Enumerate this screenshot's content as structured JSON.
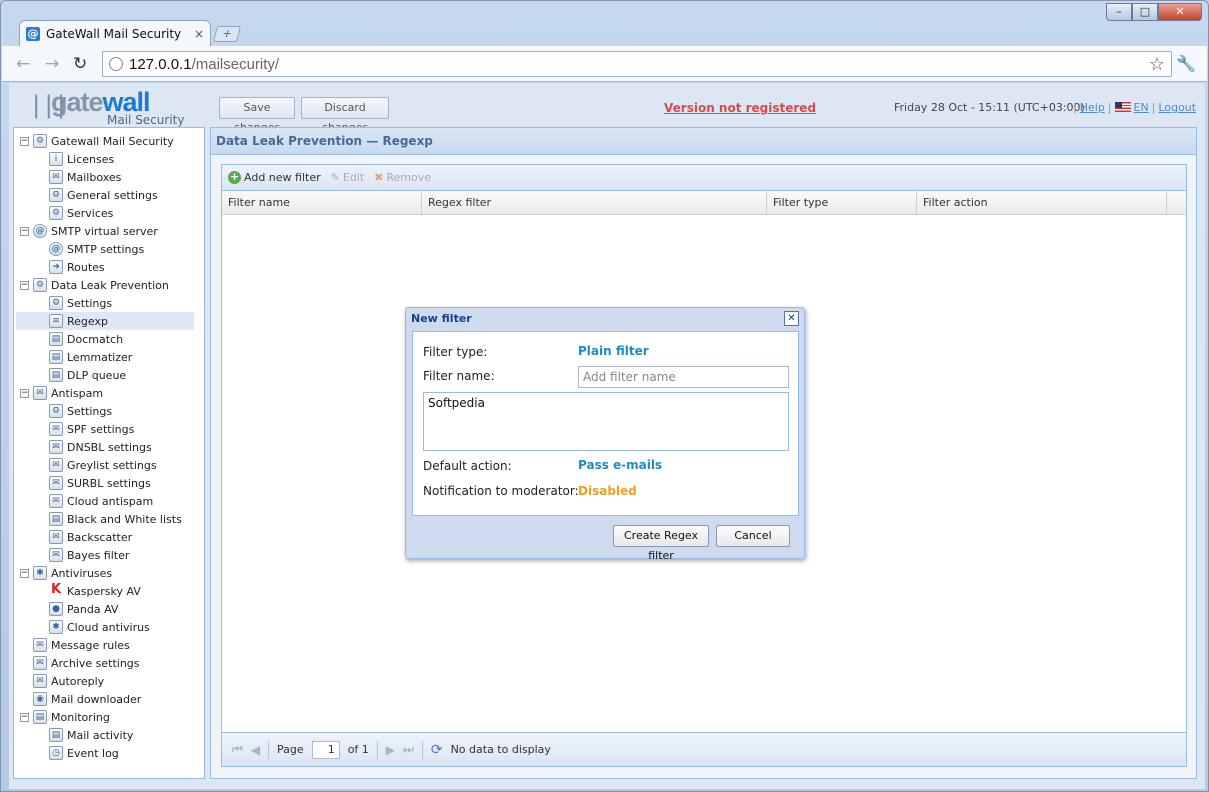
{
  "browser": {
    "tab_title": "GateWall Mail Security",
    "tab_close": "×",
    "new_tab": "+",
    "url_host": "127.0.0.1",
    "url_path": "/mailsecurity/",
    "back": "←",
    "forward": "→",
    "reload": "↻",
    "star": "☆",
    "wrench": "🔧",
    "minimize": "–",
    "maximize": "□",
    "close": "✕"
  },
  "logo": {
    "gate": "gate",
    "wall": "wall",
    "sub": "Mail Security",
    "bars": "|||"
  },
  "topbar": {
    "save_label": "Save changes",
    "discard_label": "Discard changes",
    "warning": "Version not registered",
    "datetime": "Friday 28 Oct - 15:11 (UTC+03:00)",
    "help": "Help",
    "lang": "EN",
    "logout": "Logout",
    "separator": "|"
  },
  "sidebar": {
    "items": [
      {
        "label": "Gatewall Mail Security",
        "icon": "⚙"
      },
      {
        "label": "Licenses",
        "icon": "i"
      },
      {
        "label": "Mailboxes",
        "icon": "✉"
      },
      {
        "label": "General settings",
        "icon": "⚙"
      },
      {
        "label": "Services",
        "icon": "⚙"
      },
      {
        "label": "SMTP virtual server",
        "icon": "@"
      },
      {
        "label": "SMTP settings",
        "icon": "@"
      },
      {
        "label": "Routes",
        "icon": "➜"
      },
      {
        "label": "Data Leak Prevention",
        "icon": "⚙"
      },
      {
        "label": "Settings",
        "icon": "⚙"
      },
      {
        "label": "Regexp",
        "icon": "≡"
      },
      {
        "label": "Docmatch",
        "icon": "▤"
      },
      {
        "label": "Lemmatizer",
        "icon": "▤"
      },
      {
        "label": "DLP queue",
        "icon": "▤"
      },
      {
        "label": "Antispam",
        "icon": "✉"
      },
      {
        "label": "Settings",
        "icon": "⚙"
      },
      {
        "label": "SPF settings",
        "icon": "✉"
      },
      {
        "label": "DNSBL settings",
        "icon": "✉"
      },
      {
        "label": "Greylist settings",
        "icon": "✉"
      },
      {
        "label": "SURBL settings",
        "icon": "✉"
      },
      {
        "label": "Cloud antispam",
        "icon": "✉"
      },
      {
        "label": "Black and White lists",
        "icon": "▤"
      },
      {
        "label": "Backscatter",
        "icon": "✉"
      },
      {
        "label": "Bayes filter",
        "icon": "✉"
      },
      {
        "label": "Antiviruses",
        "icon": "✱"
      },
      {
        "label": "Kaspersky AV",
        "icon": "K"
      },
      {
        "label": "Panda AV",
        "icon": "●"
      },
      {
        "label": "Cloud antivirus",
        "icon": "✱"
      },
      {
        "label": "Message rules",
        "icon": "✉"
      },
      {
        "label": "Archive settings",
        "icon": "✉"
      },
      {
        "label": "Autoreply",
        "icon": "✉"
      },
      {
        "label": "Mail downloader",
        "icon": "◉"
      },
      {
        "label": "Monitoring",
        "icon": "▤"
      },
      {
        "label": "Mail activity",
        "icon": "▤"
      },
      {
        "label": "Event log",
        "icon": "◷"
      }
    ],
    "collapse": "−"
  },
  "main": {
    "title": "Data Leak Prevention — Regexp",
    "toolbar": {
      "add": "Add new filter",
      "edit": "Edit",
      "remove": "Remove",
      "add_icon": "+",
      "edit_icon": "✎",
      "remove_icon": "✖"
    },
    "columns": [
      "Filter name",
      "Regex filter",
      "Filter type",
      "Filter action"
    ],
    "paging": {
      "first": "⏮",
      "prev": "◀",
      "next": "▶",
      "last": "⏭",
      "page_label": "Page",
      "page": "1",
      "of": "of 1",
      "refresh": "⟳",
      "status": "No data to display"
    }
  },
  "dialog": {
    "title": "New filter",
    "close": "✕",
    "type_label": "Filter type:",
    "type_value": "Plain filter",
    "name_label": "Filter name:",
    "name_placeholder": "Add filter name",
    "text_value": "Softpedia",
    "action_label": "Default action:",
    "action_value": "Pass e-mails",
    "notify_label": "Notification to moderator:",
    "notify_value": "Disabled",
    "create_label": "Create Regex filter",
    "cancel_label": "Cancel"
  },
  "colors": {
    "accent_blue": "#1f8bc3",
    "warning_red": "#d64b4b",
    "disabled_orange": "#f0a020",
    "panel_border": "#99bbe8"
  }
}
